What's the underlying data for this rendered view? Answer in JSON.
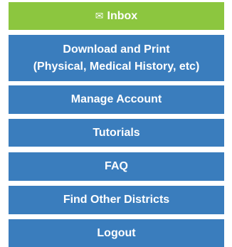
{
  "menu": {
    "inbox": {
      "icon": "envelope-icon",
      "glyph": "✉",
      "label": "Inbox",
      "color": "#8cc63f"
    },
    "download": {
      "line1": "Download and Print",
      "line2": "(Physical, Medical History, etc)"
    },
    "manage_account": "Manage Account",
    "tutorials": "Tutorials",
    "faq": "FAQ",
    "find_districts": "Find Other Districts",
    "logout": "Logout",
    "button_color": "#3a7dbd"
  }
}
